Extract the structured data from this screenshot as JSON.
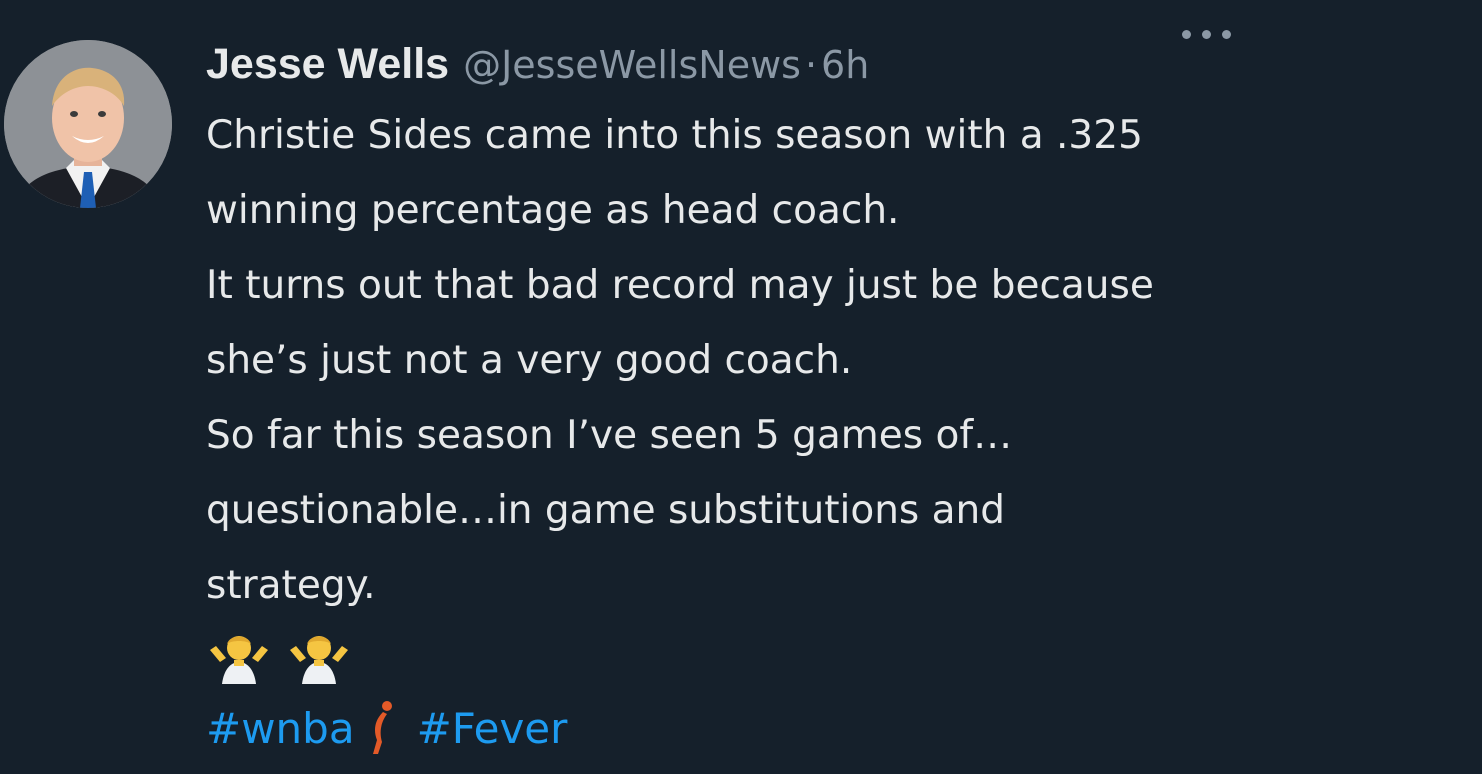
{
  "tweet": {
    "author_name": "Jesse Wells",
    "author_handle": "@JesseWellsNews",
    "separator": "·",
    "timestamp": "6h",
    "more_icon": "more-horizontal-icon",
    "text_lines": [
      "Christie Sides came into this season with a .325",
      "winning percentage as head coach.",
      "It turns out that bad record may just be because",
      "she’s just not a very good coach.",
      "So far this season I’ve seen 5 games of…",
      "questionable…in game substitutions and",
      "strategy."
    ],
    "emojis": [
      "person-shrugging",
      "person-shrugging"
    ],
    "hashtags": [
      "#wnba",
      "#Fever"
    ],
    "wnba_icon": "wnba-logo-icon"
  },
  "colors": {
    "background": "#15202b",
    "text": "#e7e9ea",
    "secondary": "#8b98a5",
    "link": "#1d9bf0",
    "wnba_logo": "#e35a28"
  }
}
